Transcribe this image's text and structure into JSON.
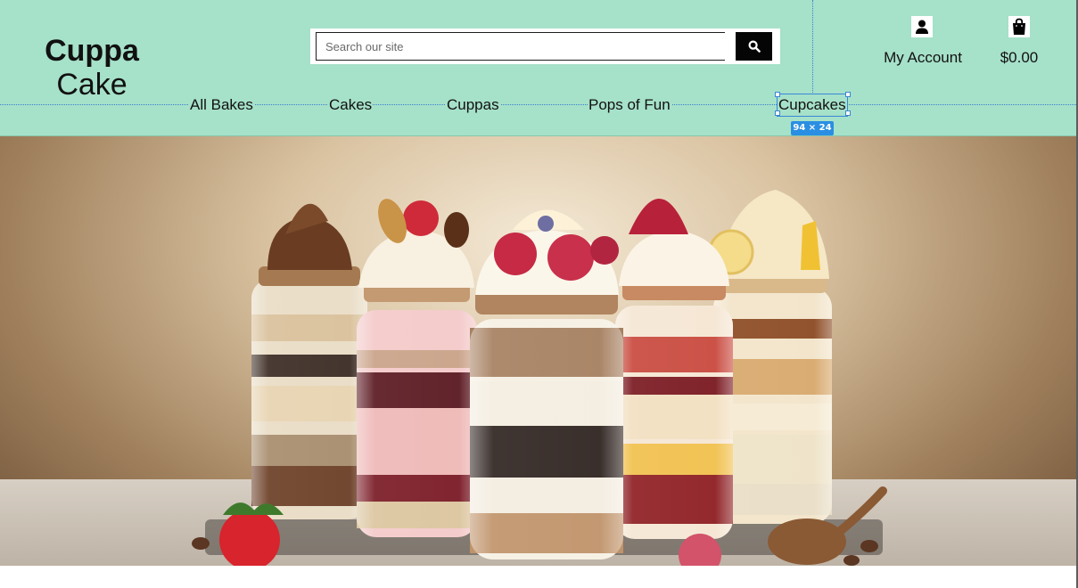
{
  "logo": {
    "line1": "Cuppa",
    "line2": "Cake"
  },
  "search": {
    "placeholder": "Search our site",
    "button_icon": "search-icon"
  },
  "account": {
    "label": "My Account",
    "icon": "user-icon"
  },
  "cart": {
    "total": "$0.00",
    "icon": "shopping-bag-icon"
  },
  "nav": {
    "items": [
      {
        "label": "All Bakes"
      },
      {
        "label": "Cakes"
      },
      {
        "label": "Cuppas"
      },
      {
        "label": "Pops of Fun"
      },
      {
        "label": "Cupcakes"
      }
    ],
    "selected": "Cupcakes"
  },
  "selection_badge": {
    "label": "94 × 24"
  },
  "hero": {
    "image": "layered dessert jars with whipped cream, berries and chocolate"
  },
  "colors": {
    "header_bg": "#a6e1c9",
    "accent": "#3a86d8",
    "button_bg": "#050505"
  }
}
